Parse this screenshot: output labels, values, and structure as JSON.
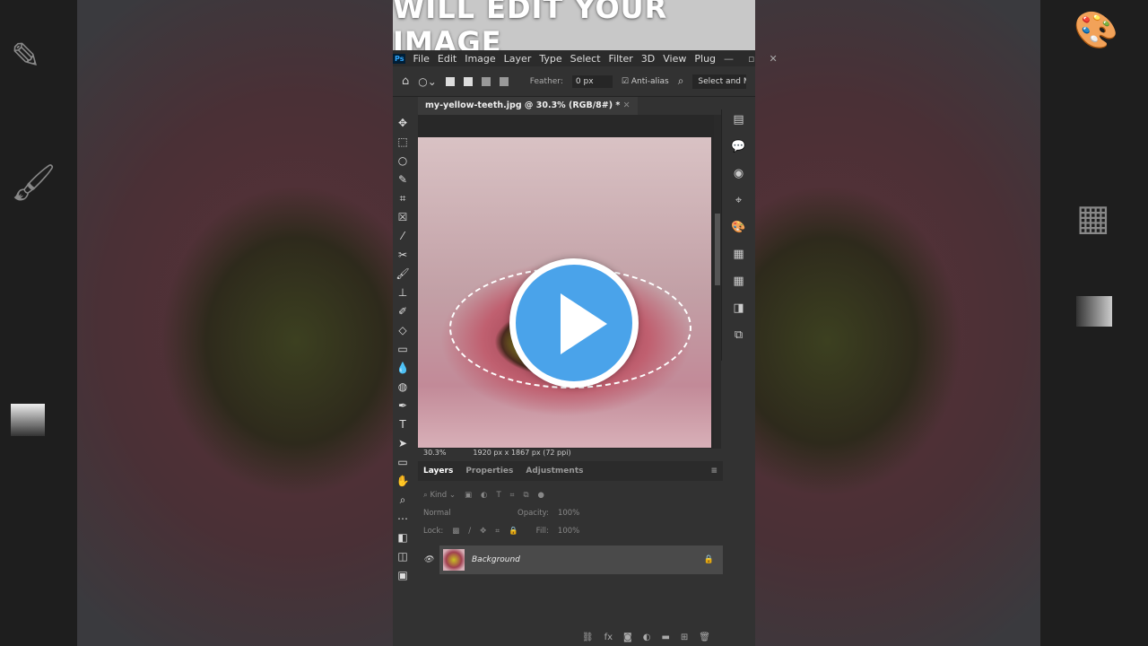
{
  "banner": {
    "title": "WILL EDIT YOUR IMAGE"
  },
  "menu": {
    "logo": "Ps",
    "items": [
      "File",
      "Edit",
      "Image",
      "Layer",
      "Type",
      "Select",
      "Filter",
      "3D",
      "View",
      "Plug"
    ]
  },
  "options": {
    "feather_label": "Feather:",
    "feather_value": "0 px",
    "antialias_label": "Anti-alias",
    "antialias_checked": true,
    "select_mask": "Select and Mask"
  },
  "document": {
    "tab_title": "my-yellow-teeth.jpg @ 30.3% (RGB/8#) *",
    "zoom": "30.3%",
    "dimensions": "1920 px x 1867 px (72 ppi)"
  },
  "panels": {
    "tabs": [
      "Layers",
      "Properties",
      "Adjustments"
    ],
    "filter_kind": "Kind",
    "blend_mode": "Normal",
    "opacity_label": "Opacity:",
    "opacity": "100%",
    "lock_label": "Lock:",
    "fill_label": "Fill:",
    "fill": "100%"
  },
  "layers": [
    {
      "name": "Background",
      "visible": true,
      "locked": true
    }
  ],
  "colors": {
    "play_button": "#4aa3ea",
    "ps_bg": "#323232"
  },
  "overlay": {
    "icon": "play-icon"
  }
}
